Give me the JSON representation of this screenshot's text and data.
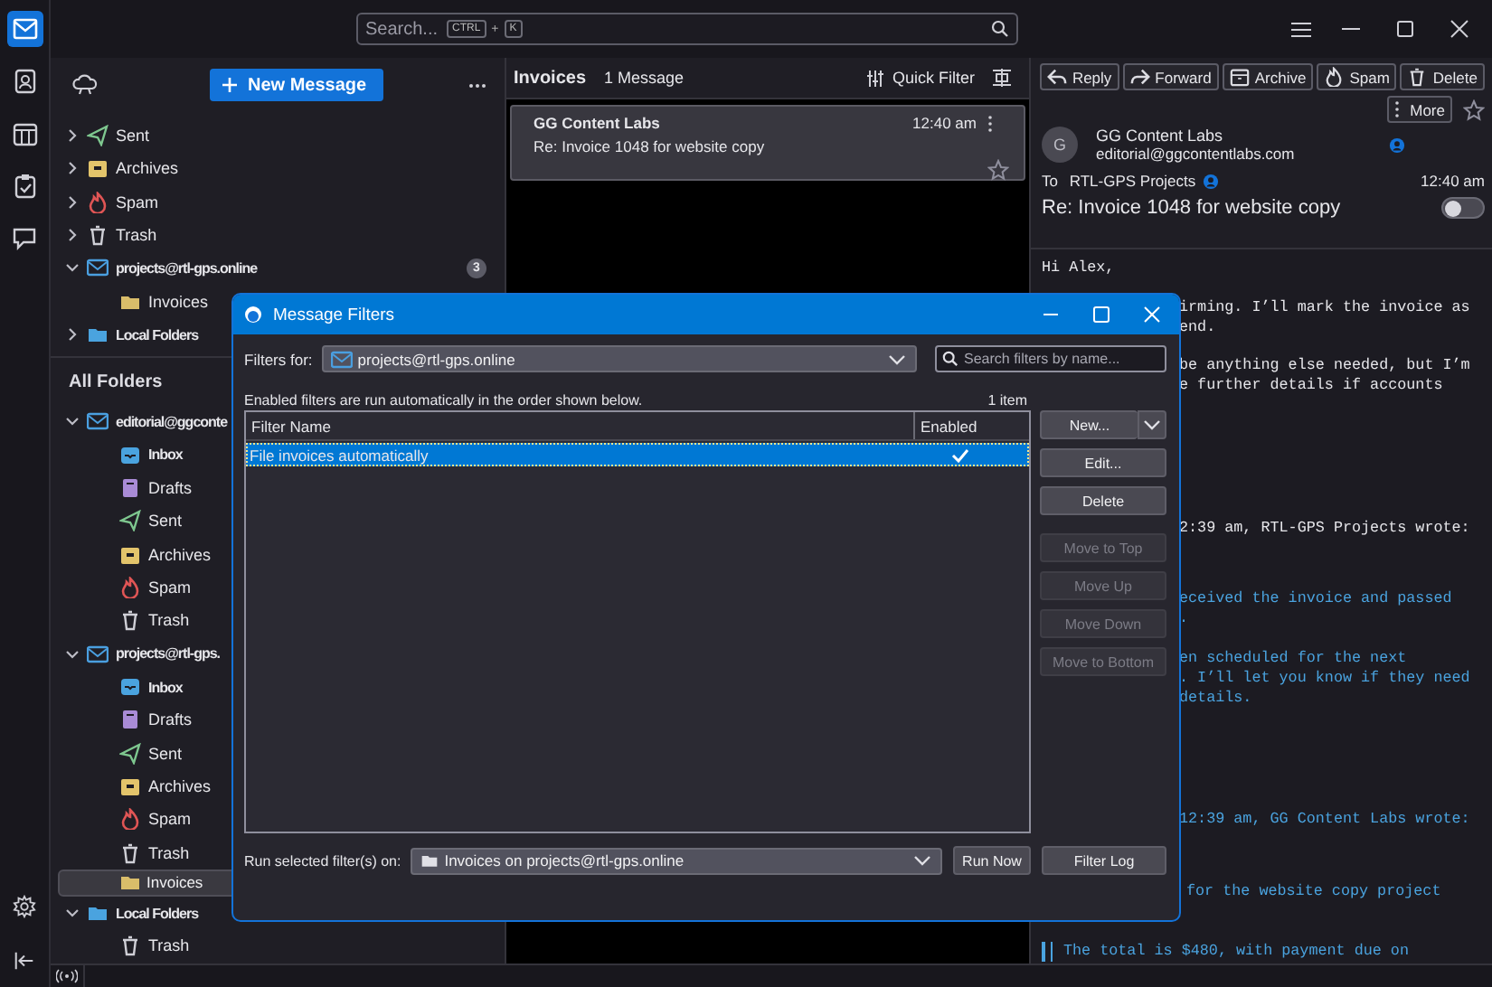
{
  "spaces": [
    {
      "kind": "mail",
      "selected": true
    },
    {
      "kind": "address-book",
      "selected": false
    },
    {
      "kind": "calendar",
      "selected": false
    },
    {
      "kind": "tasks",
      "selected": false
    },
    {
      "kind": "chat",
      "selected": false
    }
  ],
  "search": {
    "placeholder": "Search...",
    "keys": [
      "CTRL",
      "+",
      "K"
    ]
  },
  "folder_pane": {
    "new_message": "New Message",
    "folders": [
      {
        "name": "Sent",
        "kind": "sent",
        "expanded": false,
        "selected": false
      },
      {
        "name": "Archives",
        "kind": "archive",
        "expanded": false,
        "selected": false
      },
      {
        "name": "Spam",
        "kind": "spam",
        "expanded": false,
        "selected": false
      },
      {
        "name": "Trash",
        "kind": "trash",
        "expanded": false,
        "selected": false
      },
      {
        "name": "projects@rtl-gps.online",
        "kind": "account",
        "expanded": true,
        "selected": false,
        "badge": "3",
        "children": [
          {
            "name": "Invoices",
            "kind": "folder",
            "selected": false
          }
        ]
      },
      {
        "name": "Local Folders",
        "kind": "local",
        "expanded": false,
        "selected": false
      }
    ],
    "all_folders_title": "All Folders",
    "all_folders": [
      {
        "name": "editorial@ggconte",
        "kind": "account",
        "expanded": true,
        "selected": false,
        "children": [
          {
            "name": "Inbox",
            "kind": "inbox",
            "selected": false,
            "unread": true
          },
          {
            "name": "Drafts",
            "kind": "drafts",
            "selected": false,
            "unread": false
          },
          {
            "name": "Sent",
            "kind": "sent",
            "selected": false,
            "unread": false
          },
          {
            "name": "Archives",
            "kind": "archive",
            "selected": false,
            "unread": false
          },
          {
            "name": "Spam",
            "kind": "spam",
            "selected": false,
            "unread": false
          },
          {
            "name": "Trash",
            "kind": "trash",
            "selected": false,
            "unread": false
          }
        ]
      },
      {
        "name": "projects@rtl-gps.",
        "kind": "account",
        "expanded": true,
        "selected": false,
        "children": [
          {
            "name": "Inbox",
            "kind": "inbox",
            "selected": false,
            "unread": true
          },
          {
            "name": "Drafts",
            "kind": "drafts",
            "selected": false,
            "unread": false
          },
          {
            "name": "Sent",
            "kind": "sent",
            "selected": false,
            "unread": false
          },
          {
            "name": "Archives",
            "kind": "archive",
            "selected": false,
            "unread": false
          },
          {
            "name": "Spam",
            "kind": "spam",
            "selected": false,
            "unread": false
          },
          {
            "name": "Trash",
            "kind": "trash",
            "selected": false,
            "unread": false
          },
          {
            "name": "Invoices",
            "kind": "folder",
            "selected": true,
            "unread": false
          }
        ]
      },
      {
        "name": "Local Folders",
        "kind": "local",
        "expanded": true,
        "selected": false,
        "children": [
          {
            "name": "Trash",
            "kind": "trash",
            "selected": false,
            "unread": false
          }
        ]
      }
    ]
  },
  "message_list": {
    "folder": "Invoices",
    "count": "1 Message",
    "quick_filter": "Quick Filter",
    "messages": [
      {
        "sender": "GG Content Labs",
        "time": "12:40 am",
        "subject": "Re: Invoice 1048 for website copy",
        "selected": true,
        "starred": false
      }
    ]
  },
  "reader": {
    "actions": [
      {
        "label": "Reply",
        "kind": "reply"
      },
      {
        "label": "Forward",
        "kind": "forward"
      },
      {
        "label": "Archive",
        "kind": "archive"
      },
      {
        "label": "Spam",
        "kind": "spam"
      },
      {
        "label": "Delete",
        "kind": "delete"
      }
    ],
    "more": "More",
    "starred": false,
    "avatar": "G",
    "from_name": "GG Content Labs",
    "from_email": "editorial@ggcontentlabs.com",
    "to_label": "To",
    "to": "RTL-GPS Projects",
    "time": "12:40 am",
    "subject": "Re: Invoice 1048 for website copy",
    "dark_mode": false,
    "body": [
      {
        "kind": "text",
        "clipped": false,
        "lines": [
          "Hi Alex,"
        ]
      },
      {
        "kind": "text",
        "clipped": true,
        "lines": [
          "irming. I’ll mark the invoice as",
          "end."
        ]
      },
      {
        "kind": "text",
        "clipped": true,
        "lines": [
          "be anything else needed, but I’m",
          "e further details if accounts"
        ]
      },
      {
        "kind": "text",
        "clipped": true,
        "lines": [
          "2:39 am, RTL-GPS Projects wrote:"
        ]
      },
      {
        "kind": "quote",
        "clipped": true,
        "lines": [
          "eceived the invoice and passed",
          "."
        ]
      },
      {
        "kind": "quote",
        "clipped": true,
        "lines": [
          "en scheduled for the next",
          ". I’ll let you know if they need",
          "details."
        ]
      },
      {
        "kind": "quote",
        "clipped": true,
        "lines": [
          "12:39 am, GG Content Labs wrote:"
        ]
      },
      {
        "kind": "nested",
        "clipped": true,
        "lines": [
          "for the website copy project"
        ]
      },
      {
        "kind": "nested",
        "clipped": false,
        "lines": [
          "The total is $480, with payment due on"
        ]
      }
    ]
  },
  "dialog": {
    "title": "Message Filters",
    "filters_for_label": "Filters for:",
    "account": "projects@rtl-gps.online",
    "search_placeholder": "Search filters by name...",
    "info": "Enabled filters are run automatically in the order shown below.",
    "count": "1 item",
    "columns": [
      "Filter Name",
      "Enabled"
    ],
    "filters": [
      {
        "name": "File invoices automatically",
        "enabled": true,
        "selected": true
      }
    ],
    "buttons": [
      {
        "label": "New...",
        "kind": "split",
        "disabled": false
      },
      {
        "label": "Edit...",
        "kind": "plain",
        "disabled": false
      },
      {
        "label": "Delete",
        "kind": "plain",
        "disabled": false
      },
      {
        "label": "Move to Top",
        "kind": "plain",
        "disabled": true
      },
      {
        "label": "Move Up",
        "kind": "plain",
        "disabled": true
      },
      {
        "label": "Move Down",
        "kind": "plain",
        "disabled": true
      },
      {
        "label": "Move to Bottom",
        "kind": "plain",
        "disabled": true
      }
    ],
    "run_on_label": "Run selected filter(s) on:",
    "run_on_folder": "Invoices on projects@rtl-gps.online",
    "run_now": "Run Now",
    "filter_log": "Filter Log"
  }
}
